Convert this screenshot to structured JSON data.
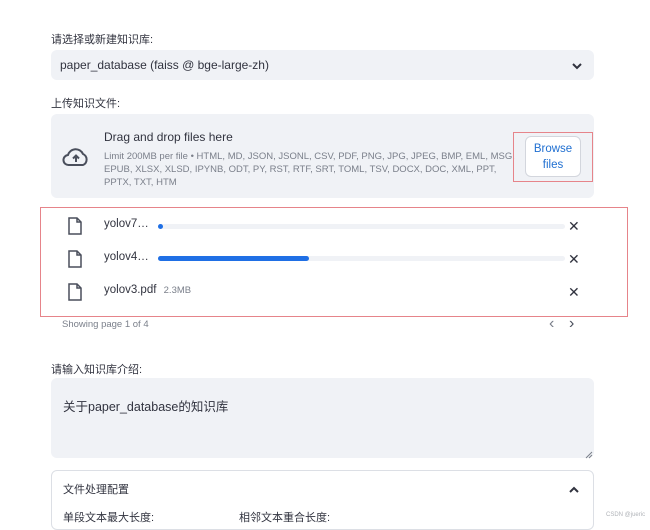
{
  "kb_select": {
    "label": "请选择或新建知识库:",
    "value": "paper_database (faiss @ bge-large-zh)"
  },
  "upload": {
    "label": "上传知识文件:",
    "drag_text": "Drag and drop files here",
    "limit_text": "Limit 200MB per file • HTML, MD, JSON, JSONL, CSV, PDF, PNG, JPG, JPEG, BMP, EML, MSG, EPUB, XLSX, XLSD, IPYNB, ODT, PY, RST, RTF, SRT, TOML, TSV, DOCX, DOC, XML, PPT, PPTX, TXT, HTM",
    "browse_line1": "Browse",
    "browse_line2": "files",
    "files": [
      {
        "name": "yolov7…",
        "progress": 0.01
      },
      {
        "name": "yolov4…",
        "progress": 0.37
      },
      {
        "name": "yolov3.pdf",
        "size": "2.3MB"
      }
    ],
    "remove_glyph": "✕",
    "pagination": "Showing page 1 of 4",
    "prev_glyph": "‹",
    "next_glyph": "›"
  },
  "intro": {
    "label": "请输入知识库介绍:",
    "value": "关于paper_database的知识库"
  },
  "config": {
    "title": "文件处理配置",
    "max_len_label": "单段文本最大长度:",
    "overlap_label": "相邻文本重合长度:"
  },
  "watermark": "CSDN @jueric",
  "colors": {
    "accent": "#1f6fe5",
    "input_bg": "#f0f2f6",
    "annotation_red": "#e6848a"
  }
}
